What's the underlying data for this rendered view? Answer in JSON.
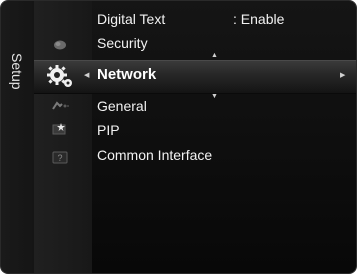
{
  "category": {
    "label": "Setup"
  },
  "side_icons": [
    "picture-icon",
    "setup-icon",
    "input-icon",
    "application-icon",
    "support-icon"
  ],
  "menu": {
    "items": [
      {
        "label": "Digital Text",
        "value": ": Enable"
      },
      {
        "label": "Security"
      },
      {
        "label": "Network",
        "selected": true
      },
      {
        "label": "General"
      },
      {
        "label": "PIP"
      },
      {
        "label": "Common Interface"
      }
    ]
  },
  "colors": {
    "background": "#0d0d0d",
    "text": "#f2f2f2",
    "highlight": "#2a2a2a"
  }
}
